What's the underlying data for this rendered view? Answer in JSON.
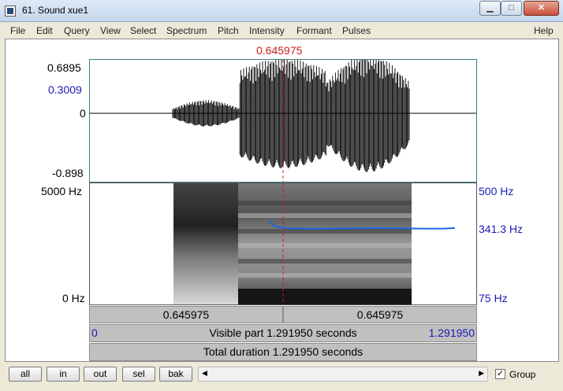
{
  "window": {
    "title": "61. Sound xue1",
    "min": "▁",
    "max": "□",
    "close": "✕"
  },
  "menu": [
    "File",
    "Edit",
    "Query",
    "View",
    "Select",
    "Spectrum",
    "Pitch",
    "Intensity",
    "Formant",
    "Pulses"
  ],
  "help": "Help",
  "cursor_time": "0.645975",
  "waveform": {
    "max": "0.6895",
    "pitch_cursor": "0.3009",
    "zero": "0",
    "min": "-0.898"
  },
  "spectrogram": {
    "freq_top": "5000 Hz",
    "freq_bottom": "0 Hz"
  },
  "pitch_axis": {
    "top": "500 Hz",
    "current": "341.3 Hz",
    "bottom": "75 Hz"
  },
  "time_bars": {
    "left_segment": "0.645975",
    "right_segment": "0.645975",
    "visible_start": "0",
    "visible_label": "Visible part 1.291950 seconds",
    "visible_end": "1.291950",
    "total_label": "Total duration 1.291950 seconds"
  },
  "toolbar": {
    "all": "all",
    "in": "in",
    "out": "out",
    "sel": "sel",
    "bak": "bak",
    "group_checked": true,
    "group_label": "Group"
  },
  "colors": {
    "cursor": "#c8201c",
    "pitch": "#1e64e6",
    "axis_label": "#1a1ab4"
  },
  "chart_data": {
    "type": "line",
    "title": "",
    "xlabel": "",
    "ylabel": "",
    "xlim": [
      0,
      1.29195
    ],
    "ylim": [
      75,
      500
    ],
    "series": [
      {
        "x": [
          0.6,
          0.62,
          0.66,
          0.72,
          0.8,
          0.88,
          0.96,
          1.04,
          1.12,
          1.18,
          1.22
        ],
        "values": [
          368,
          348,
          342,
          341,
          341,
          342,
          343,
          342,
          341,
          341,
          343
        ]
      }
    ]
  }
}
